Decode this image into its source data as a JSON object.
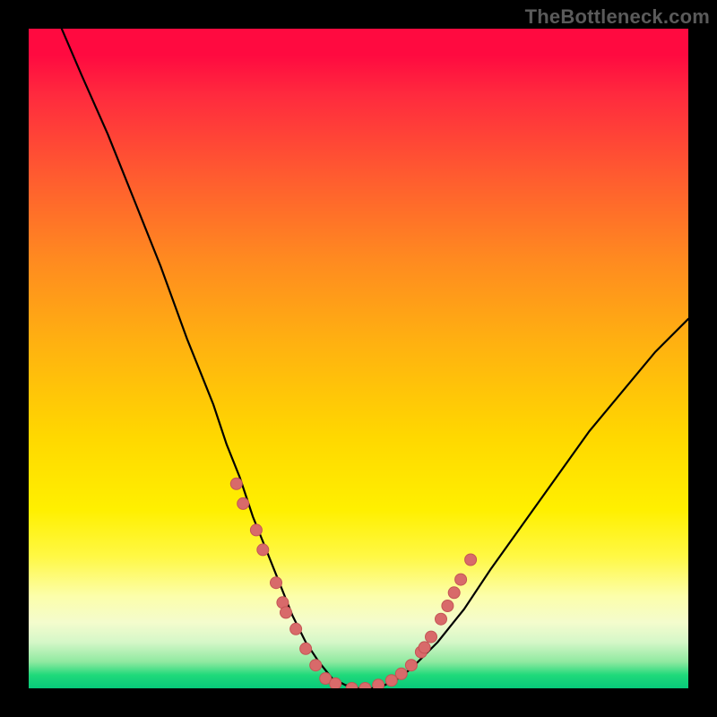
{
  "watermark": "TheBottleneck.com",
  "colors": {
    "background": "#000000",
    "curve": "#000000",
    "marker_fill": "#d86a6a",
    "marker_stroke": "#c45555",
    "gradient_top": "#ff0a40",
    "gradient_bottom": "#07c97a"
  },
  "chart_data": {
    "type": "line",
    "title": "",
    "xlabel": "",
    "ylabel": "",
    "xlim": [
      0,
      100
    ],
    "ylim": [
      0,
      100
    ],
    "note": "No axis ticks or numeric labels are rendered in the image; values are relative percentages estimated from pixel positions. y=100 at top, y=0 at bottom.",
    "series": [
      {
        "name": "curve",
        "x": [
          5,
          8,
          12,
          16,
          20,
          24,
          26,
          28,
          30,
          32,
          34,
          36,
          38,
          40,
          42,
          44,
          46,
          48,
          50,
          52,
          54,
          56,
          58,
          62,
          66,
          70,
          75,
          80,
          85,
          90,
          95,
          100
        ],
        "y": [
          100,
          93,
          84,
          74,
          64,
          53,
          48,
          43,
          37,
          32,
          26,
          21,
          16,
          11,
          7,
          4,
          1.5,
          0.5,
          0,
          0,
          0.5,
          1.5,
          3,
          7,
          12,
          18,
          25,
          32,
          39,
          45,
          51,
          56
        ]
      }
    ],
    "markers": [
      {
        "x": 31.5,
        "y": 31
      },
      {
        "x": 32.5,
        "y": 28
      },
      {
        "x": 34.5,
        "y": 24
      },
      {
        "x": 35.5,
        "y": 21
      },
      {
        "x": 37.5,
        "y": 16
      },
      {
        "x": 38.5,
        "y": 13
      },
      {
        "x": 39.0,
        "y": 11.5
      },
      {
        "x": 40.5,
        "y": 9
      },
      {
        "x": 42.0,
        "y": 6
      },
      {
        "x": 43.5,
        "y": 3.5
      },
      {
        "x": 45.0,
        "y": 1.5
      },
      {
        "x": 46.5,
        "y": 0.7
      },
      {
        "x": 49.0,
        "y": 0
      },
      {
        "x": 51.0,
        "y": 0
      },
      {
        "x": 53.0,
        "y": 0.5
      },
      {
        "x": 55.0,
        "y": 1.2
      },
      {
        "x": 56.5,
        "y": 2.2
      },
      {
        "x": 58.0,
        "y": 3.5
      },
      {
        "x": 59.5,
        "y": 5.5
      },
      {
        "x": 60.0,
        "y": 6.2
      },
      {
        "x": 61.0,
        "y": 7.8
      },
      {
        "x": 62.5,
        "y": 10.5
      },
      {
        "x": 63.5,
        "y": 12.5
      },
      {
        "x": 64.5,
        "y": 14.5
      },
      {
        "x": 65.5,
        "y": 16.5
      },
      {
        "x": 67.0,
        "y": 19.5
      }
    ]
  }
}
